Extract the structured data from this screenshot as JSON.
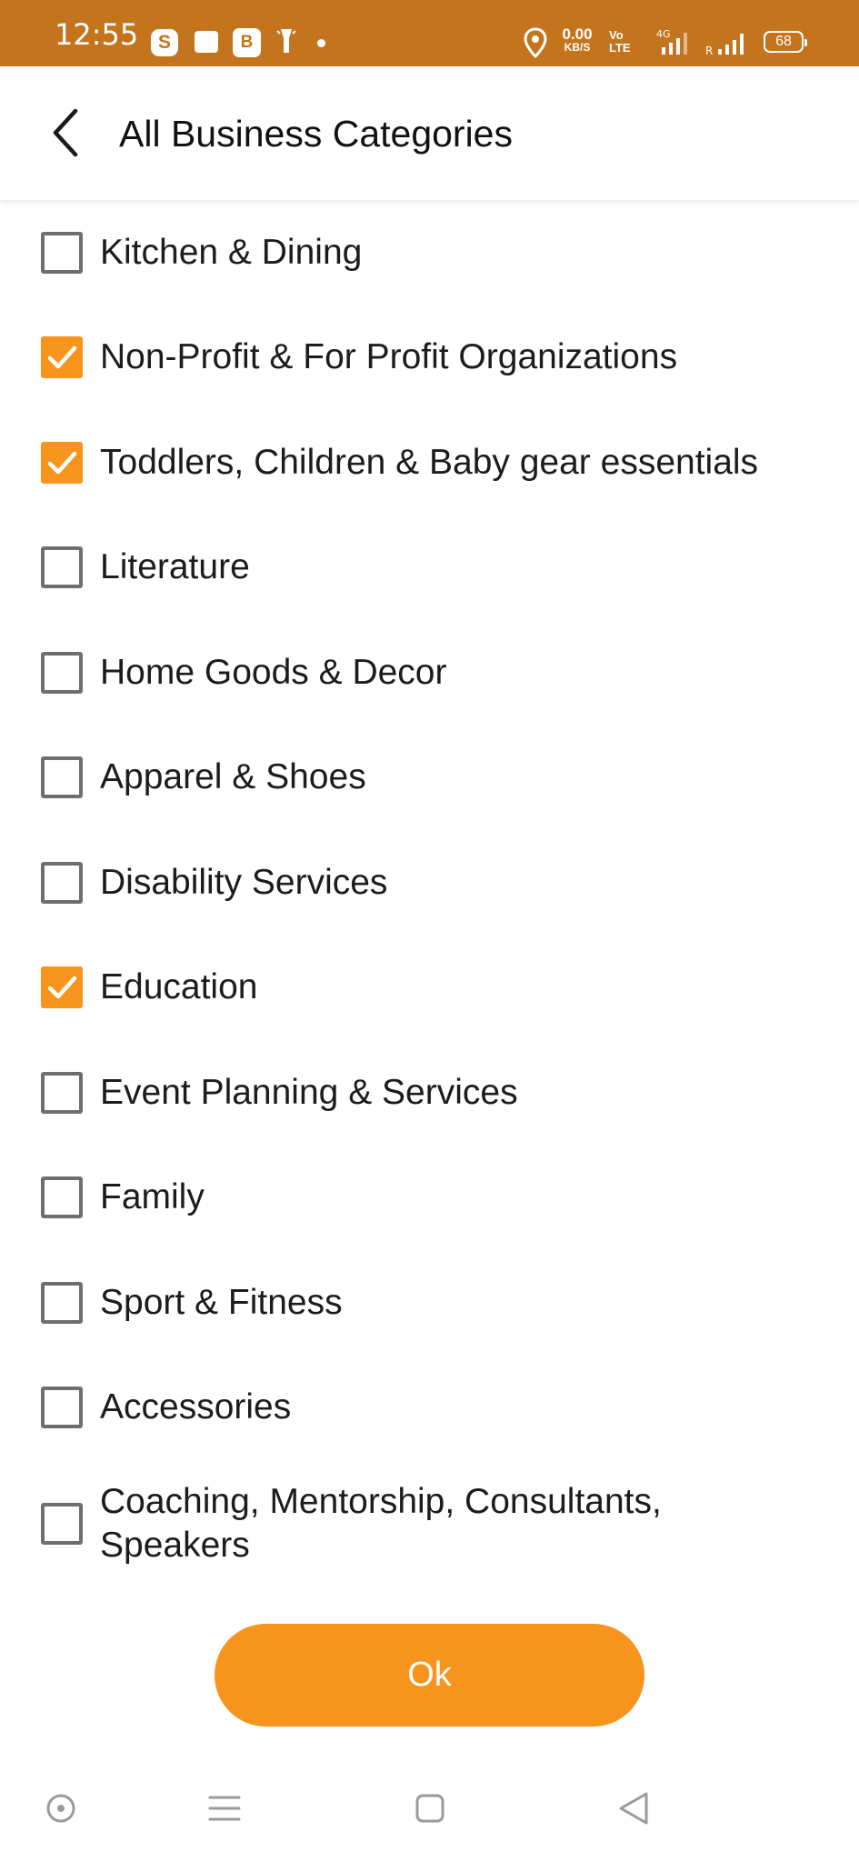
{
  "status_bar": {
    "time": "12:55",
    "s_icon": "S",
    "b_icon": "B",
    "net_rate": "0.00",
    "net_unit": "KB/S",
    "volte_top": "Vo",
    "volte_bottom": "LTE",
    "network_type": "4G",
    "roaming": "R",
    "battery": "68",
    "background_color": "#c4741d"
  },
  "header": {
    "title": "All Business Categories",
    "back_icon": "chevron-left-icon"
  },
  "categories": [
    {
      "label": "Kitchen & Dining",
      "checked": false
    },
    {
      "label": "Non-Profit & For Profit Organizations",
      "checked": true
    },
    {
      "label": "Toddlers, Children & Baby gear essentials",
      "checked": true
    },
    {
      "label": "Literature",
      "checked": false
    },
    {
      "label": "Home Goods & Decor",
      "checked": false
    },
    {
      "label": "Apparel & Shoes",
      "checked": false
    },
    {
      "label": "Disability Services",
      "checked": false
    },
    {
      "label": "Education",
      "checked": true
    },
    {
      "label": "Event Planning & Services",
      "checked": false
    },
    {
      "label": "Family",
      "checked": false
    },
    {
      "label": "Sport & Fitness",
      "checked": false
    },
    {
      "label": "Accessories",
      "checked": false
    },
    {
      "label": "Coaching, Mentorship, Consultants, Speakers",
      "checked": false
    }
  ],
  "ok_button": {
    "label": "Ok"
  },
  "colors": {
    "accent": "#f7941d",
    "unchecked_border": "#6e6e6e"
  },
  "nav_bar": {
    "icons": [
      "circle-dot-icon",
      "menu-icon",
      "square-home-icon",
      "triangle-back-icon"
    ]
  }
}
